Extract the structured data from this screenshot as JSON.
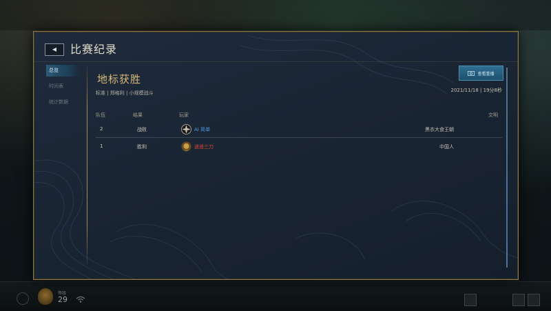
{
  "window": {
    "title": "比赛纪录"
  },
  "sidebar": {
    "items": [
      {
        "label": "总览",
        "active": true
      },
      {
        "label": "时间表",
        "active": false
      },
      {
        "label": "统计数据",
        "active": false
      }
    ]
  },
  "match": {
    "title": "地标获胜",
    "details": "标准 | 郑格利 | 小规模战斗",
    "date": "2021/11/18 | 19分8秒",
    "replay_label": "查看重播"
  },
  "table": {
    "headers": {
      "team": "队伍",
      "result": "结果",
      "player": "玩家",
      "civ": "文明"
    },
    "rows": [
      {
        "team": "2",
        "result": "战败",
        "player": "AI 简单",
        "civ": "黑衣大食王朝",
        "player_color": "#4f9be0",
        "icon": "ai-icon"
      },
      {
        "team": "1",
        "result": "胜利",
        "player": "逍遥三刀",
        "civ": "中国人",
        "player_color": "#e24a3a",
        "icon": "player-emblem-icon"
      }
    ]
  },
  "bottom": {
    "level_label": "等级",
    "level": "29"
  },
  "colors": {
    "accent_gold": "#d6b878",
    "panel_border": "#8e7a4f",
    "active_nav": "#2a5a78"
  }
}
